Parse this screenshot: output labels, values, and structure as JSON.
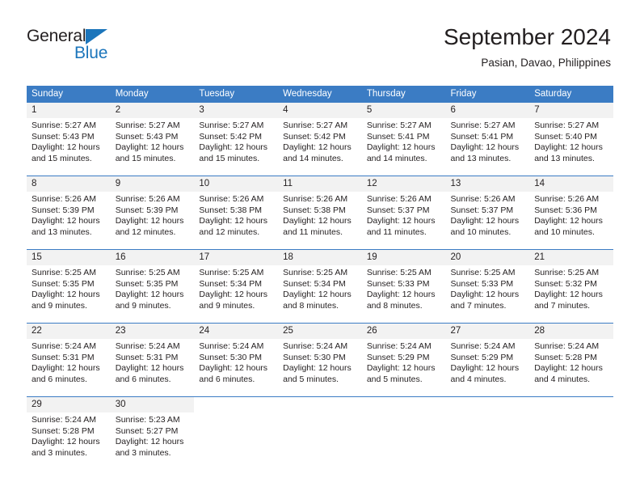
{
  "logo": {
    "word_top": "General",
    "word_bottom": "Blue",
    "triangle_color": "#1b75bb",
    "text_color": "#231f20"
  },
  "header": {
    "title": "September 2024",
    "subtitle": "Pasian, Davao, Philippines"
  },
  "theme": {
    "header_blue": "#3b7cc4",
    "daynum_gray": "#f2f2f2",
    "text": "#231f20"
  },
  "calendar": {
    "weekdays": [
      "Sunday",
      "Monday",
      "Tuesday",
      "Wednesday",
      "Thursday",
      "Friday",
      "Saturday"
    ],
    "weeks": [
      [
        {
          "day": "1",
          "sunrise": "Sunrise: 5:27 AM",
          "sunset": "Sunset: 5:43 PM",
          "daylight_1": "Daylight: 12 hours",
          "daylight_2": "and 15 minutes."
        },
        {
          "day": "2",
          "sunrise": "Sunrise: 5:27 AM",
          "sunset": "Sunset: 5:43 PM",
          "daylight_1": "Daylight: 12 hours",
          "daylight_2": "and 15 minutes."
        },
        {
          "day": "3",
          "sunrise": "Sunrise: 5:27 AM",
          "sunset": "Sunset: 5:42 PM",
          "daylight_1": "Daylight: 12 hours",
          "daylight_2": "and 15 minutes."
        },
        {
          "day": "4",
          "sunrise": "Sunrise: 5:27 AM",
          "sunset": "Sunset: 5:42 PM",
          "daylight_1": "Daylight: 12 hours",
          "daylight_2": "and 14 minutes."
        },
        {
          "day": "5",
          "sunrise": "Sunrise: 5:27 AM",
          "sunset": "Sunset: 5:41 PM",
          "daylight_1": "Daylight: 12 hours",
          "daylight_2": "and 14 minutes."
        },
        {
          "day": "6",
          "sunrise": "Sunrise: 5:27 AM",
          "sunset": "Sunset: 5:41 PM",
          "daylight_1": "Daylight: 12 hours",
          "daylight_2": "and 13 minutes."
        },
        {
          "day": "7",
          "sunrise": "Sunrise: 5:27 AM",
          "sunset": "Sunset: 5:40 PM",
          "daylight_1": "Daylight: 12 hours",
          "daylight_2": "and 13 minutes."
        }
      ],
      [
        {
          "day": "8",
          "sunrise": "Sunrise: 5:26 AM",
          "sunset": "Sunset: 5:39 PM",
          "daylight_1": "Daylight: 12 hours",
          "daylight_2": "and 13 minutes."
        },
        {
          "day": "9",
          "sunrise": "Sunrise: 5:26 AM",
          "sunset": "Sunset: 5:39 PM",
          "daylight_1": "Daylight: 12 hours",
          "daylight_2": "and 12 minutes."
        },
        {
          "day": "10",
          "sunrise": "Sunrise: 5:26 AM",
          "sunset": "Sunset: 5:38 PM",
          "daylight_1": "Daylight: 12 hours",
          "daylight_2": "and 12 minutes."
        },
        {
          "day": "11",
          "sunrise": "Sunrise: 5:26 AM",
          "sunset": "Sunset: 5:38 PM",
          "daylight_1": "Daylight: 12 hours",
          "daylight_2": "and 11 minutes."
        },
        {
          "day": "12",
          "sunrise": "Sunrise: 5:26 AM",
          "sunset": "Sunset: 5:37 PM",
          "daylight_1": "Daylight: 12 hours",
          "daylight_2": "and 11 minutes."
        },
        {
          "day": "13",
          "sunrise": "Sunrise: 5:26 AM",
          "sunset": "Sunset: 5:37 PM",
          "daylight_1": "Daylight: 12 hours",
          "daylight_2": "and 10 minutes."
        },
        {
          "day": "14",
          "sunrise": "Sunrise: 5:26 AM",
          "sunset": "Sunset: 5:36 PM",
          "daylight_1": "Daylight: 12 hours",
          "daylight_2": "and 10 minutes."
        }
      ],
      [
        {
          "day": "15",
          "sunrise": "Sunrise: 5:25 AM",
          "sunset": "Sunset: 5:35 PM",
          "daylight_1": "Daylight: 12 hours",
          "daylight_2": "and 9 minutes."
        },
        {
          "day": "16",
          "sunrise": "Sunrise: 5:25 AM",
          "sunset": "Sunset: 5:35 PM",
          "daylight_1": "Daylight: 12 hours",
          "daylight_2": "and 9 minutes."
        },
        {
          "day": "17",
          "sunrise": "Sunrise: 5:25 AM",
          "sunset": "Sunset: 5:34 PM",
          "daylight_1": "Daylight: 12 hours",
          "daylight_2": "and 9 minutes."
        },
        {
          "day": "18",
          "sunrise": "Sunrise: 5:25 AM",
          "sunset": "Sunset: 5:34 PM",
          "daylight_1": "Daylight: 12 hours",
          "daylight_2": "and 8 minutes."
        },
        {
          "day": "19",
          "sunrise": "Sunrise: 5:25 AM",
          "sunset": "Sunset: 5:33 PM",
          "daylight_1": "Daylight: 12 hours",
          "daylight_2": "and 8 minutes."
        },
        {
          "day": "20",
          "sunrise": "Sunrise: 5:25 AM",
          "sunset": "Sunset: 5:33 PM",
          "daylight_1": "Daylight: 12 hours",
          "daylight_2": "and 7 minutes."
        },
        {
          "day": "21",
          "sunrise": "Sunrise: 5:25 AM",
          "sunset": "Sunset: 5:32 PM",
          "daylight_1": "Daylight: 12 hours",
          "daylight_2": "and 7 minutes."
        }
      ],
      [
        {
          "day": "22",
          "sunrise": "Sunrise: 5:24 AM",
          "sunset": "Sunset: 5:31 PM",
          "daylight_1": "Daylight: 12 hours",
          "daylight_2": "and 6 minutes."
        },
        {
          "day": "23",
          "sunrise": "Sunrise: 5:24 AM",
          "sunset": "Sunset: 5:31 PM",
          "daylight_1": "Daylight: 12 hours",
          "daylight_2": "and 6 minutes."
        },
        {
          "day": "24",
          "sunrise": "Sunrise: 5:24 AM",
          "sunset": "Sunset: 5:30 PM",
          "daylight_1": "Daylight: 12 hours",
          "daylight_2": "and 6 minutes."
        },
        {
          "day": "25",
          "sunrise": "Sunrise: 5:24 AM",
          "sunset": "Sunset: 5:30 PM",
          "daylight_1": "Daylight: 12 hours",
          "daylight_2": "and 5 minutes."
        },
        {
          "day": "26",
          "sunrise": "Sunrise: 5:24 AM",
          "sunset": "Sunset: 5:29 PM",
          "daylight_1": "Daylight: 12 hours",
          "daylight_2": "and 5 minutes."
        },
        {
          "day": "27",
          "sunrise": "Sunrise: 5:24 AM",
          "sunset": "Sunset: 5:29 PM",
          "daylight_1": "Daylight: 12 hours",
          "daylight_2": "and 4 minutes."
        },
        {
          "day": "28",
          "sunrise": "Sunrise: 5:24 AM",
          "sunset": "Sunset: 5:28 PM",
          "daylight_1": "Daylight: 12 hours",
          "daylight_2": "and 4 minutes."
        }
      ],
      [
        {
          "day": "29",
          "sunrise": "Sunrise: 5:24 AM",
          "sunset": "Sunset: 5:28 PM",
          "daylight_1": "Daylight: 12 hours",
          "daylight_2": "and 3 minutes."
        },
        {
          "day": "30",
          "sunrise": "Sunrise: 5:23 AM",
          "sunset": "Sunset: 5:27 PM",
          "daylight_1": "Daylight: 12 hours",
          "daylight_2": "and 3 minutes."
        },
        {
          "day": "",
          "sunrise": "",
          "sunset": "",
          "daylight_1": "",
          "daylight_2": ""
        },
        {
          "day": "",
          "sunrise": "",
          "sunset": "",
          "daylight_1": "",
          "daylight_2": ""
        },
        {
          "day": "",
          "sunrise": "",
          "sunset": "",
          "daylight_1": "",
          "daylight_2": ""
        },
        {
          "day": "",
          "sunrise": "",
          "sunset": "",
          "daylight_1": "",
          "daylight_2": ""
        },
        {
          "day": "",
          "sunrise": "",
          "sunset": "",
          "daylight_1": "",
          "daylight_2": ""
        }
      ]
    ]
  }
}
